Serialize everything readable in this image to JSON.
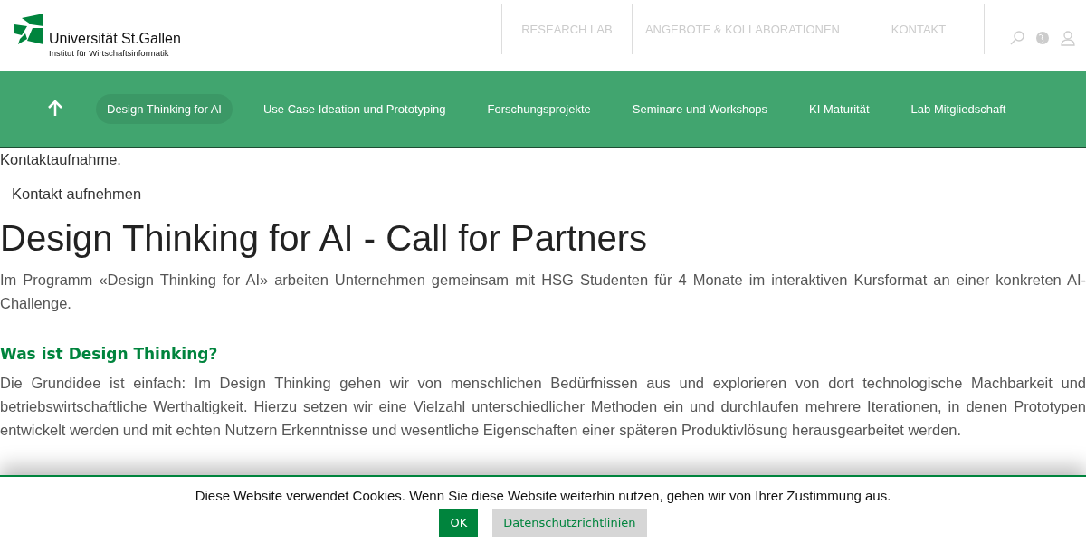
{
  "header": {
    "logo": {
      "name": "Universität St.Gallen",
      "subtitle": "Institut für Wirtschaftsinformatik"
    },
    "top_nav": [
      {
        "label": "RESEARCH LAB"
      },
      {
        "label": "ANGEBOTE & KOLLABORATIONEN"
      },
      {
        "label": "KONTAKT"
      }
    ]
  },
  "sub_nav": {
    "items": [
      {
        "label": "Design Thinking for AI",
        "selected": true
      },
      {
        "label": "Use Case Ideation und Prototyping",
        "selected": false
      },
      {
        "label": "Forschungsprojekte",
        "selected": false
      },
      {
        "label": "Seminare und Workshops",
        "selected": false
      },
      {
        "label": "KI Maturität",
        "selected": false
      },
      {
        "label": "Lab Mitgliedschaft",
        "selected": false
      }
    ]
  },
  "content": {
    "intro_tail": "Kontaktaufnahme.",
    "contact_link": "Kontakt aufnehmen",
    "title": "Design Thinking for AI - Call for Partners",
    "lead": "Im Programm «Design Thinking for AI» arbeiten Unternehmen gemeinsam mit HSG Studenten für 4 Monate im interaktiven Kursformat an einer konkreten AI-Challenge.",
    "section_heading": "Was ist Design Thinking?",
    "section_text": "Die Grundidee ist einfach: Im Design Thinking gehen wir von menschlichen Bedürfnissen aus und explorieren von dort technologische Machbarkeit und betriebswirtschaftliche Werthaltigkeit. Hierzu setzen wir eine Vielzahl unterschiedlicher Methoden ein und durchlaufen mehrere Iterationen, in denen Prototypen entwickelt werden und mit echten Nutzern Erkenntnisse und wesentliche Eigenschaften einer späteren Produktivlösung herausgearbeitet werden."
  },
  "cookie_banner": {
    "message": "Diese Website verwendet Cookies. Wenn Sie diese Website weiterhin nutzen, gehen wir von Ihrer Zustimmung aus.",
    "buttons": [
      "OK",
      "Datenschutzrichtlinien"
    ]
  }
}
